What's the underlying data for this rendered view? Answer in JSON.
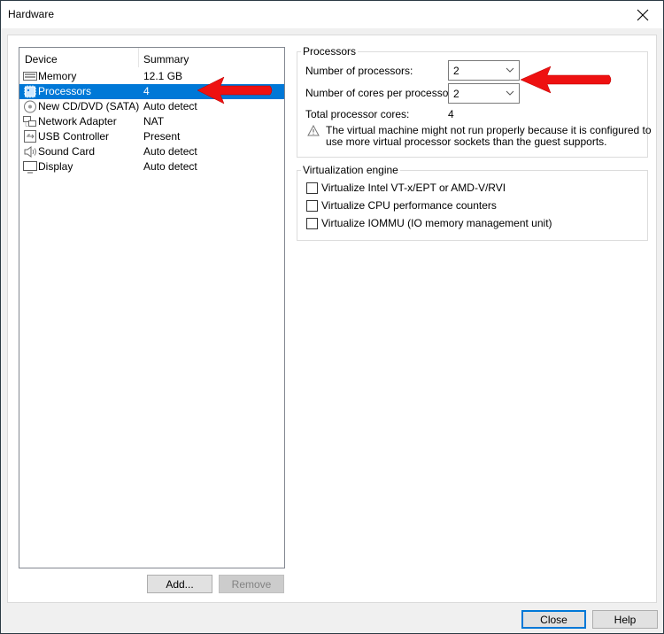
{
  "window": {
    "title": "Hardware",
    "close_icon": "close-x-icon"
  },
  "device_list": {
    "columns": {
      "device": "Device",
      "summary": "Summary"
    },
    "selected_index": 1,
    "items": [
      {
        "name": "Memory",
        "summary": "12.1 GB",
        "icon": "memory-icon"
      },
      {
        "name": "Processors",
        "summary": "4",
        "icon": "processor-icon"
      },
      {
        "name": "New CD/DVD (SATA)",
        "summary": "Auto detect",
        "icon": "cd-dvd-icon"
      },
      {
        "name": "Network Adapter",
        "summary": "NAT",
        "icon": "network-adapter-icon"
      },
      {
        "name": "USB Controller",
        "summary": "Present",
        "icon": "usb-icon"
      },
      {
        "name": "Sound Card",
        "summary": "Auto detect",
        "icon": "speaker-icon"
      },
      {
        "name": "Display",
        "summary": "Auto detect",
        "icon": "monitor-icon"
      }
    ],
    "add_label": "Add...",
    "remove_label": "Remove"
  },
  "processors": {
    "group_label": "Processors",
    "num_processors_label": "Number of processors:",
    "num_processors_value": "2",
    "cores_per_processor_label": "Number of cores per processor:",
    "cores_per_processor_value": "2",
    "total_cores_label": "Total processor cores:",
    "total_cores_value": "4",
    "warning_icon": "warning-icon",
    "warning_line1": "The virtual machine might not run properly because it is configured to",
    "warning_line2": "use more virtual processor sockets than the guest supports."
  },
  "virtualization": {
    "group_label": "Virtualization engine",
    "options": [
      {
        "label": "Virtualize Intel VT-x/EPT or AMD-V/RVI",
        "checked": false
      },
      {
        "label": "Virtualize CPU performance counters",
        "checked": false
      },
      {
        "label": "Virtualize IOMMU (IO memory management unit)",
        "checked": false
      }
    ]
  },
  "footer": {
    "close_label": "Close",
    "help_label": "Help"
  },
  "annotations": {
    "arrow_color": "#ee1111"
  },
  "colors": {
    "selection": "#0078d7",
    "default_button_border": "#0078d7"
  }
}
